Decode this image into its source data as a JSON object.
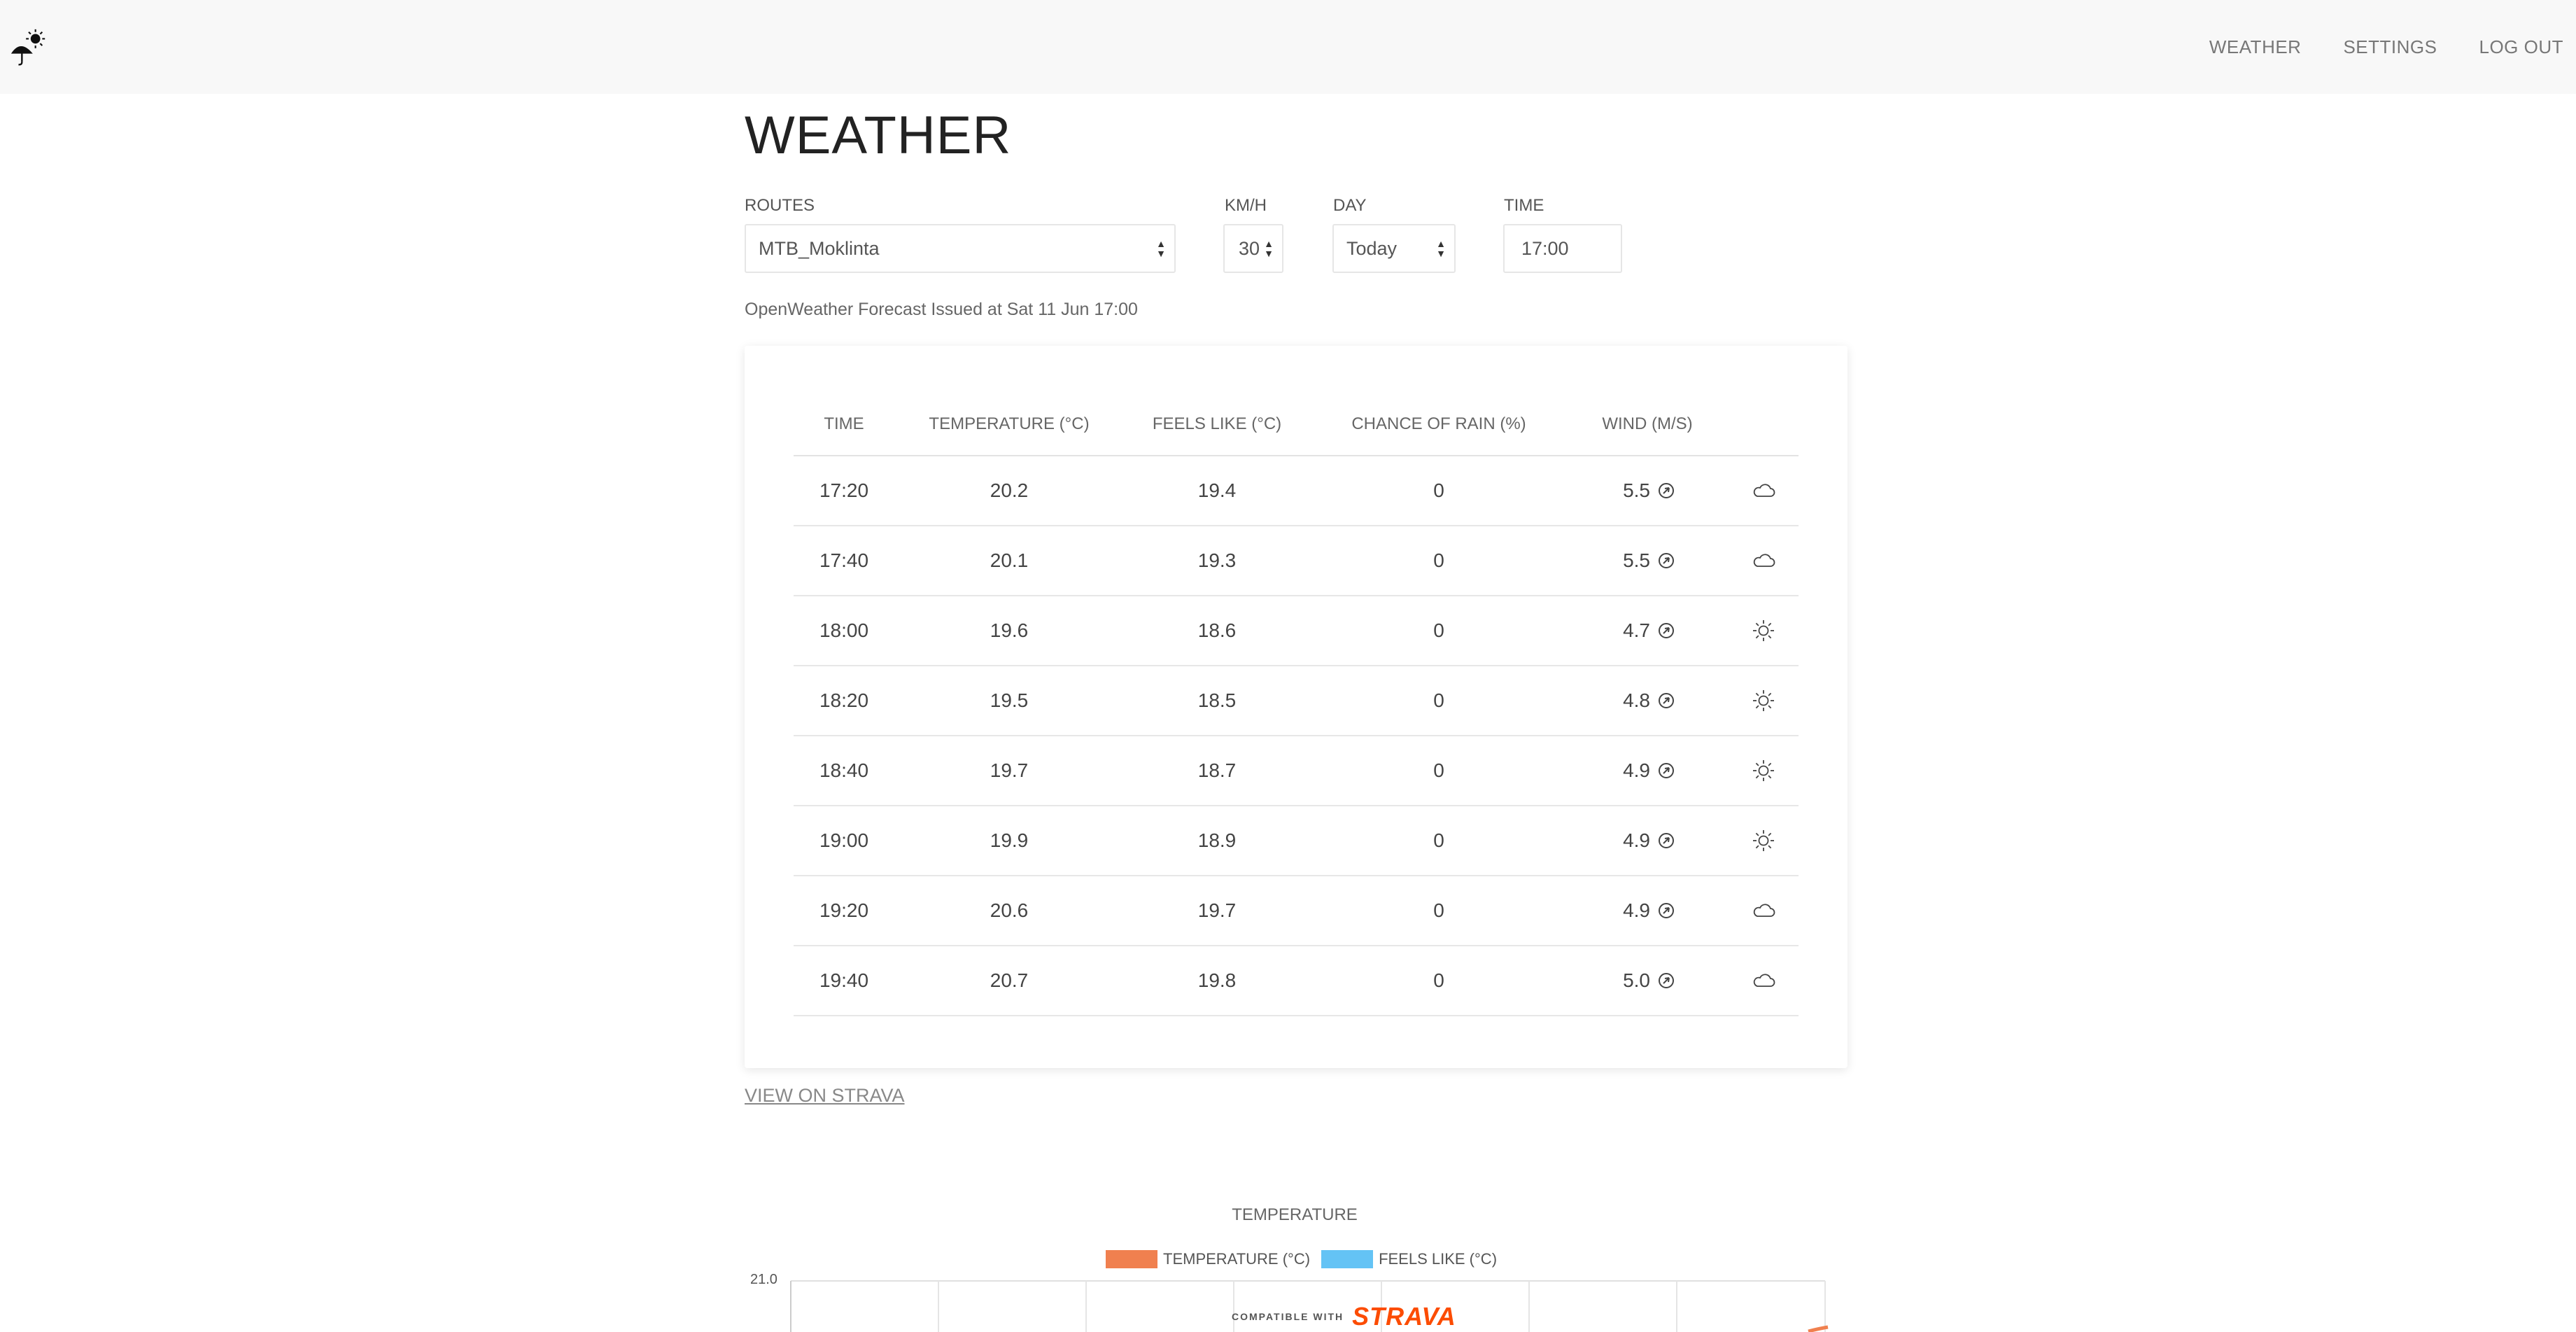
{
  "nav": {
    "links": [
      "WEATHER",
      "SETTINGS",
      "LOG OUT"
    ]
  },
  "page": {
    "title": "WEATHER"
  },
  "controls": {
    "routes": {
      "label": "ROUTES",
      "value": "MTB_Moklinta"
    },
    "speed": {
      "label": "KM/H",
      "value": "30"
    },
    "day": {
      "label": "DAY",
      "value": "Today"
    },
    "time": {
      "label": "TIME",
      "value": "17:00"
    }
  },
  "forecast_info": "OpenWeather Forecast Issued at Sat 11 Jun 17:00",
  "table": {
    "headers": [
      "TIME",
      "TEMPERATURE (°C)",
      "FEELS LIKE (°C)",
      "CHANCE OF RAIN (%)",
      "WIND (M/S)"
    ],
    "rows": [
      {
        "time": "17:20",
        "temp": "20.2",
        "feels": "19.4",
        "rain": "0",
        "wind": "5.5",
        "icon": "cloud-icon"
      },
      {
        "time": "17:40",
        "temp": "20.1",
        "feels": "19.3",
        "rain": "0",
        "wind": "5.5",
        "icon": "cloud-icon"
      },
      {
        "time": "18:00",
        "temp": "19.6",
        "feels": "18.6",
        "rain": "0",
        "wind": "4.7",
        "icon": "sun-icon"
      },
      {
        "time": "18:20",
        "temp": "19.5",
        "feels": "18.5",
        "rain": "0",
        "wind": "4.8",
        "icon": "sun-icon"
      },
      {
        "time": "18:40",
        "temp": "19.7",
        "feels": "18.7",
        "rain": "0",
        "wind": "4.9",
        "icon": "sun-icon"
      },
      {
        "time": "19:00",
        "temp": "19.9",
        "feels": "18.9",
        "rain": "0",
        "wind": "4.9",
        "icon": "sun-icon"
      },
      {
        "time": "19:20",
        "temp": "20.6",
        "feels": "19.7",
        "rain": "0",
        "wind": "4.9",
        "icon": "cloud-icon"
      },
      {
        "time": "19:40",
        "temp": "20.7",
        "feels": "19.8",
        "rain": "0",
        "wind": "5.0",
        "icon": "cloud-icon"
      }
    ]
  },
  "strava_link": "VIEW ON STRAVA",
  "chart": {
    "title": "TEMPERATURE",
    "legend": [
      {
        "label": "TEMPERATURE (°C)",
        "color": "#f0804f"
      },
      {
        "label": "FEELS LIKE (°C)",
        "color": "#64c3f5"
      }
    ],
    "y_tick_top": "21.0"
  },
  "strava_badge": {
    "small": "COMPATIBLE WITH",
    "logo": "STRAVA"
  },
  "colors": {
    "navbar_bg": "#f8f8f8",
    "strava_orange": "#fc4c02"
  }
}
